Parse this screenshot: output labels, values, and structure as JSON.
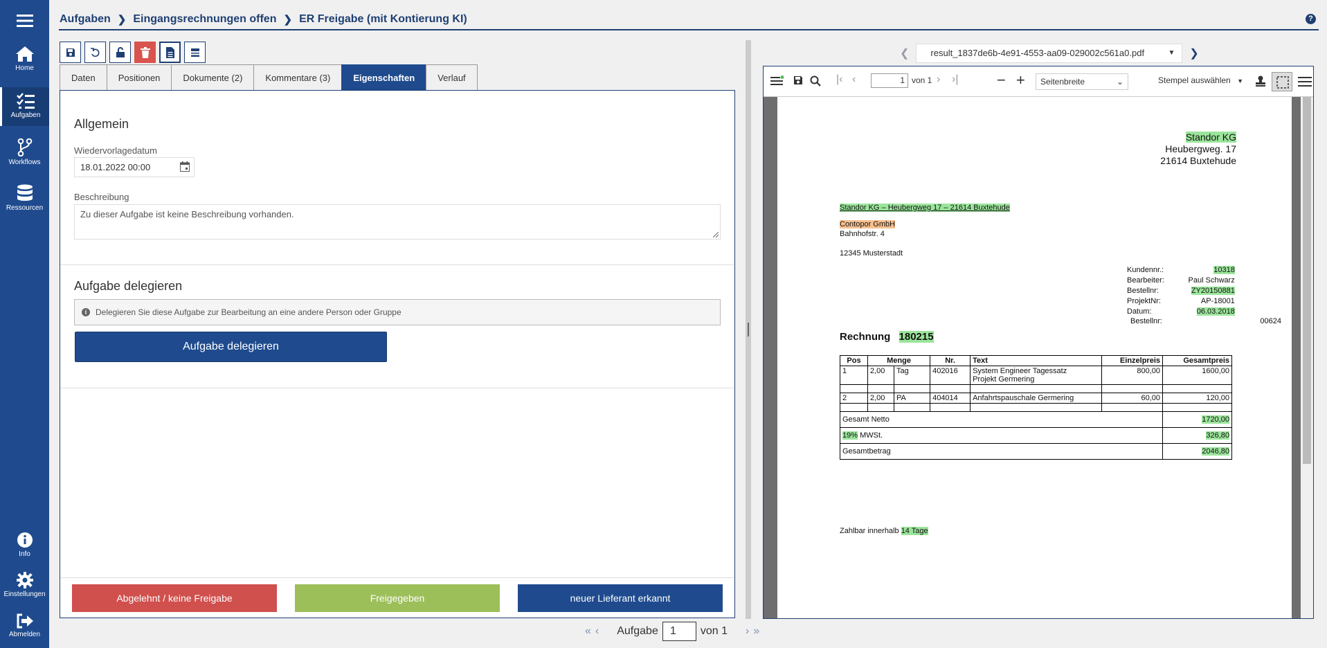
{
  "sidebar": {
    "items": [
      {
        "label": "Home",
        "icon": "home-icon"
      },
      {
        "label": "Aufgaben",
        "icon": "tasks-icon"
      },
      {
        "label": "Workflows",
        "icon": "workflow-icon"
      },
      {
        "label": "Ressourcen",
        "icon": "database-icon"
      }
    ],
    "bottom_items": [
      {
        "label": "Info",
        "icon": "info-icon"
      },
      {
        "label": "Einstellungen",
        "icon": "gear-icon"
      },
      {
        "label": "Abmelden",
        "icon": "logout-icon"
      }
    ]
  },
  "breadcrumb": [
    "Aufgaben",
    "Eingangsrechnungen offen",
    "ER Freigabe (mit Kontierung KI)"
  ],
  "help_label": "?",
  "tabs": [
    {
      "label": "Daten"
    },
    {
      "label": "Positionen"
    },
    {
      "label": "Dokumente (2)"
    },
    {
      "label": "Kommentare (3)"
    },
    {
      "label": "Eigenschaften"
    },
    {
      "label": "Verlauf"
    }
  ],
  "general": {
    "title": "Allgemein",
    "date_label": "Wiedervorlagedatum",
    "date_value": "18.01.2022 00:00",
    "description_label": "Beschreibung",
    "description_value": "Zu dieser Aufgabe ist keine Beschreibung vorhanden."
  },
  "delegate": {
    "title": "Aufgabe delegieren",
    "info": "Delegieren Sie diese Aufgabe zur Bearbeitung an eine andere Person oder Gruppe",
    "button": "Aufgabe delegieren"
  },
  "footer_buttons": {
    "reject": "Abgelehnt / keine Freigabe",
    "approve": "Freigegeben",
    "new_supplier": "neuer Lieferant erkannt"
  },
  "colors": {
    "reject": "#d0504d",
    "approve": "#9dbf5a",
    "new_supplier": "#1f4b8e"
  },
  "pager": {
    "label": "Aufgabe",
    "current": "1",
    "of": "von 1"
  },
  "pdf": {
    "filename": "result_1837de6b-4e91-4553-aa09-029002c561a0.pdf",
    "page_current": "1",
    "page_of": "von 1",
    "zoom": "Seitenbreite",
    "stamp": "Stempel auswählen",
    "sender_name": "Standor KG",
    "sender_street": "Heubergweg. 17",
    "sender_city": "21614 Buxtehude",
    "return_address": "Standor KG – Heubergweg 17 – 21614 Buxtehude",
    "recipient_name": "Contopor GmbH",
    "recipient_street": "Bahnhofstr. 4",
    "recipient_city": "12345 Musterstadt",
    "meta": [
      {
        "label": "Kundennr.:",
        "value": "10318",
        "hl": true
      },
      {
        "label": "Bearbeiter:",
        "value": "Paul Schwarz",
        "hl": false
      },
      {
        "label": "Bestellnr:",
        "value": "ZY20150881",
        "hl": true
      },
      {
        "label": "ProjektNr:",
        "value": "AP-18001",
        "hl": false
      },
      {
        "label": "Datum:",
        "value": "06.03.2018",
        "hl": true
      }
    ],
    "order_label": "Bestellnr:",
    "order_value": "00624",
    "invoice_label": "Rechnung",
    "invoice_number": "180215",
    "table_headers": [
      "Pos",
      "Menge",
      "Nr.",
      "Text",
      "Einzelpreis",
      "Gesamtpreis"
    ],
    "rows": [
      {
        "pos": "1",
        "qty": "2,00",
        "unit": "Tag",
        "nr": "402016",
        "text1": "System Engineer Tagessatz",
        "text2": "Projekt Germering",
        "unit_price": "800,00",
        "total": "1600,00"
      },
      {
        "pos": "2",
        "qty": "2,00",
        "unit": "PA",
        "nr": "404014",
        "text1": "Anfahrtspauschale Germering",
        "text2": "",
        "unit_price": "60,00",
        "total": "120,00"
      }
    ],
    "net_label": "Gesamt Netto",
    "net_value": "1720,00",
    "vat_percent": "19%",
    "vat_label": "MWSt.",
    "vat_value": "326,80",
    "gross_label": "Gesamtbetrag",
    "gross_value": "2046,80",
    "payment_label": "Zahlbar innerhalb",
    "payment_days": "14 Tage"
  }
}
